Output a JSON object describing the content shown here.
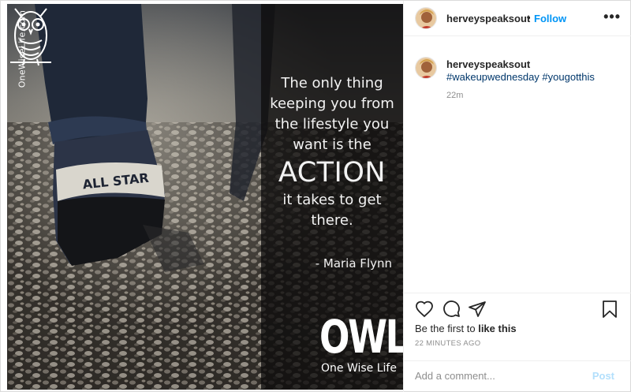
{
  "image": {
    "side_brand": "OneWiseLife.com",
    "quote_lines": [
      "The only thing",
      "keeping you from",
      "the lifestyle you",
      "want is the"
    ],
    "quote_emphasis": "ACTION",
    "quote_lines_after": [
      "it takes to get",
      "there."
    ],
    "quote_author": "- Maria Flynn",
    "logo_word": "OWL",
    "logo_tagline": "One Wise Life",
    "shoe_logo": "ALL STAR"
  },
  "post_header": {
    "username": "herveyspeaksout",
    "separator": "•",
    "follow_label": "Follow",
    "more_icon": "more-options-icon",
    "more_glyph": "•••"
  },
  "caption": {
    "username": "herveyspeaksout",
    "hashtags": "#wakeupwednesday #yougotthis",
    "relative_time": "22m"
  },
  "actions": {
    "icons": [
      "heart-icon",
      "comment-icon",
      "share-icon",
      "save-icon"
    ],
    "likes_prefix": "Be the first to ",
    "likes_action": "like this",
    "timestamp": "22 MINUTES AGO"
  },
  "comment_form": {
    "placeholder": "Add a comment...",
    "post_label": "Post"
  },
  "colors": {
    "follow_blue": "#0095f6",
    "hashtag_blue": "#00376b",
    "post_disabled": "#b2dffc",
    "muted_text": "#8e8e8e"
  }
}
